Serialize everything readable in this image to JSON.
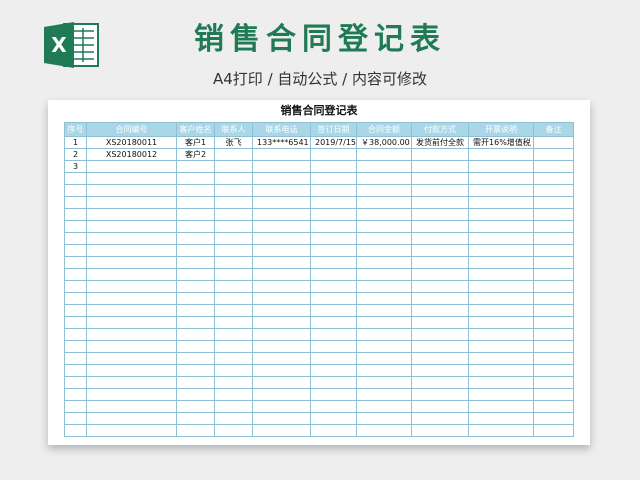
{
  "header": {
    "title": "销售合同登记表",
    "subtitle": "A4打印 / 自动公式 / 内容可修改",
    "logo_icon": "excel-icon",
    "brand_color": "#1f7a55"
  },
  "sheet": {
    "title": "销售合同登记表",
    "header_color": "#a9d7e8",
    "border_color": "#8fc0d3",
    "columns": [
      "序号",
      "合同编号",
      "客户姓名",
      "联系人",
      "联系电话",
      "签订日期",
      "合同金额",
      "付款方式",
      "开票说明",
      "备注"
    ],
    "rows": [
      [
        "1",
        "XS20180011",
        "客户1",
        "张飞",
        "133****6541",
        "2019/7/15",
        "￥38,000.00",
        "发货前付全款",
        "需开16%增值税",
        ""
      ],
      [
        "2",
        "XS20180012",
        "客户2",
        "",
        "",
        "",
        "",
        "",
        "",
        ""
      ],
      [
        "3",
        "",
        "",
        "",
        "",
        "",
        "",
        "",
        "",
        ""
      ],
      [
        "",
        "",
        "",
        "",
        "",
        "",
        "",
        "",
        "",
        ""
      ],
      [
        "",
        "",
        "",
        "",
        "",
        "",
        "",
        "",
        "",
        ""
      ],
      [
        "",
        "",
        "",
        "",
        "",
        "",
        "",
        "",
        "",
        ""
      ],
      [
        "",
        "",
        "",
        "",
        "",
        "",
        "",
        "",
        "",
        ""
      ],
      [
        "",
        "",
        "",
        "",
        "",
        "",
        "",
        "",
        "",
        ""
      ],
      [
        "",
        "",
        "",
        "",
        "",
        "",
        "",
        "",
        "",
        ""
      ],
      [
        "",
        "",
        "",
        "",
        "",
        "",
        "",
        "",
        "",
        ""
      ],
      [
        "",
        "",
        "",
        "",
        "",
        "",
        "",
        "",
        "",
        ""
      ],
      [
        "",
        "",
        "",
        "",
        "",
        "",
        "",
        "",
        "",
        ""
      ],
      [
        "",
        "",
        "",
        "",
        "",
        "",
        "",
        "",
        "",
        ""
      ],
      [
        "",
        "",
        "",
        "",
        "",
        "",
        "",
        "",
        "",
        ""
      ],
      [
        "",
        "",
        "",
        "",
        "",
        "",
        "",
        "",
        "",
        ""
      ],
      [
        "",
        "",
        "",
        "",
        "",
        "",
        "",
        "",
        "",
        ""
      ],
      [
        "",
        "",
        "",
        "",
        "",
        "",
        "",
        "",
        "",
        ""
      ],
      [
        "",
        "",
        "",
        "",
        "",
        "",
        "",
        "",
        "",
        ""
      ],
      [
        "",
        "",
        "",
        "",
        "",
        "",
        "",
        "",
        "",
        ""
      ],
      [
        "",
        "",
        "",
        "",
        "",
        "",
        "",
        "",
        "",
        ""
      ],
      [
        "",
        "",
        "",
        "",
        "",
        "",
        "",
        "",
        "",
        ""
      ],
      [
        "",
        "",
        "",
        "",
        "",
        "",
        "",
        "",
        "",
        ""
      ],
      [
        "",
        "",
        "",
        "",
        "",
        "",
        "",
        "",
        "",
        ""
      ],
      [
        "",
        "",
        "",
        "",
        "",
        "",
        "",
        "",
        "",
        ""
      ],
      [
        "",
        "",
        "",
        "",
        "",
        "",
        "",
        "",
        "",
        ""
      ]
    ]
  }
}
